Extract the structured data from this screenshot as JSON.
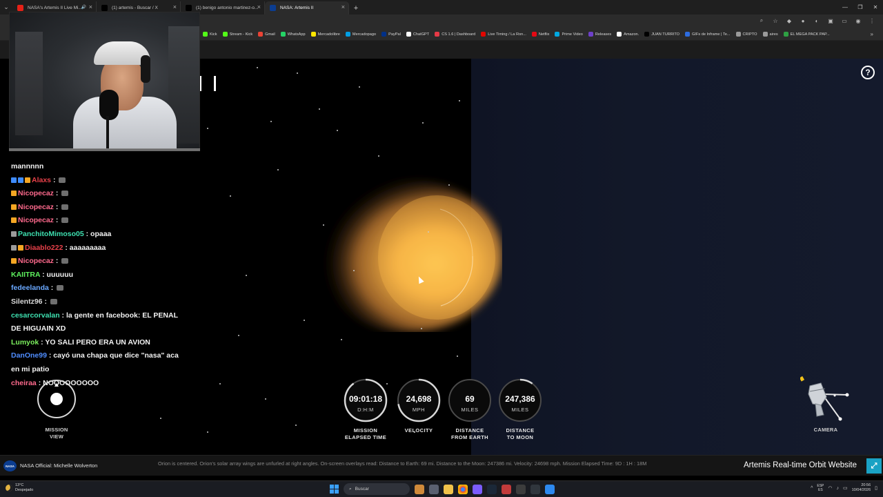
{
  "browser": {
    "tabs": [
      {
        "label": "NASA's Artemis II Live Mi...",
        "favicon_color": "#e62117",
        "active": false
      },
      {
        "label": "(1) artemis - Buscar / X",
        "favicon_color": "#000000",
        "active": false
      },
      {
        "label": "(1) benigo antonio martinez-o...",
        "favicon_color": "#000000",
        "active": false
      },
      {
        "label": "NASA: Artemis II",
        "favicon_color": "#0b3d91",
        "active": true
      }
    ],
    "new_tab_glyph": "+",
    "bookmarks": [
      {
        "label": "Kick",
        "color": "#53fc18"
      },
      {
        "label": "Stream - Kick",
        "color": "#53fc18"
      },
      {
        "label": "Gmail",
        "color": "#ea4335"
      },
      {
        "label": "WhatsApp",
        "color": "#25d366"
      },
      {
        "label": "Mercadolibre",
        "color": "#ffe600"
      },
      {
        "label": "Mercadopago",
        "color": "#009ee3"
      },
      {
        "label": "PayPal",
        "color": "#003087"
      },
      {
        "label": "ChatGPT",
        "color": "#ffffff"
      },
      {
        "label": "CS 1.6 | Dashboard",
        "color": "#e63946"
      },
      {
        "label": "Live Timing / La Ron...",
        "color": "#e10600"
      },
      {
        "label": "Netflix",
        "color": "#e50914"
      },
      {
        "label": "Prime Video",
        "color": "#00a8e1"
      },
      {
        "label": "Releases",
        "color": "#6e40c9"
      },
      {
        "label": "Amazon.",
        "color": "#ffffff"
      },
      {
        "label": "JUAN TURRITO",
        "color": "#000000"
      },
      {
        "label": "GIFs de Inframe | Te...",
        "color": "#2d6cdf"
      },
      {
        "label": "CRIPTO",
        "color": "#9a9a9a"
      },
      {
        "label": "aires",
        "color": "#9a9a9a"
      },
      {
        "label": "EL MEGA PACK PAP...",
        "color": "#2ea043"
      }
    ]
  },
  "chat": [
    {
      "user": "",
      "message": "mannnnn",
      "color": "#ffffff",
      "emote": false
    },
    {
      "user": "Alaxs",
      "message": "",
      "color": "#e8414a",
      "emote": true,
      "badges": [
        "#3f8cff",
        "#3f8cff",
        "#f5a623"
      ]
    },
    {
      "user": "Nicopecaz",
      "message": "",
      "color": "#ff6a8d",
      "emote": true,
      "badges": [
        "#f5a623"
      ]
    },
    {
      "user": "Nicopecaz",
      "message": "",
      "color": "#ff6a8d",
      "emote": true,
      "badges": [
        "#f5a623"
      ]
    },
    {
      "user": "Nicopecaz",
      "message": "",
      "color": "#ff6a8d",
      "emote": true,
      "badges": [
        "#f5a623"
      ]
    },
    {
      "user": "PanchitoMimoso05",
      "message": "opaaa",
      "color": "#3ee0b0",
      "emote": false,
      "badges": [
        "#9a9a9a"
      ]
    },
    {
      "user": "Diaablo222",
      "message": "aaaaaaaaa",
      "color": "#e8414a",
      "emote": false,
      "badges": [
        "#9a9a9a",
        "#f5a623"
      ]
    },
    {
      "user": "Nicopecaz",
      "message": "",
      "color": "#ff6a8d",
      "emote": true,
      "badges": [
        "#f5a623"
      ]
    },
    {
      "user": "KAIITRA",
      "message": "uuuuuu",
      "color": "#5ef05e",
      "emote": false
    },
    {
      "user": "fedeelanda",
      "message": "",
      "color": "#6aa8ff",
      "emote": true
    },
    {
      "user": "Silentz96",
      "message": "",
      "color": "#dcdcdc",
      "emote": true
    },
    {
      "user": "cesarcorvalan",
      "message": "la gente en facebook: EL PENAL DE HIGUAIN XD",
      "color": "#3ee0b0",
      "emote": false
    },
    {
      "user": "Lumyok",
      "message": "YO SALI PERO ERA UN AVION",
      "color": "#7cf05e",
      "emote": false
    },
    {
      "user": "DanOne99",
      "message": "cayó una chapa que dice \"nasa\" aca en mi patio",
      "color": "#4f8dff",
      "emote": false
    },
    {
      "user": "cheiraa",
      "message": "NOOOOOOOOO",
      "color": "#ff6a8d",
      "emote": false
    }
  ],
  "controls": {
    "help_glyph": "?",
    "mission_view_label_1": "MISSION",
    "mission_view_label_2": "VIEW",
    "camera_label": "CAMERA"
  },
  "stats": [
    {
      "value": "09:01:18",
      "unit": "D:H:M",
      "label_1": "MISSION",
      "label_2": "ELAPSED TIME",
      "fraction": 0.9
    },
    {
      "value": "24,698",
      "unit": "MPH",
      "label_1": "VELOCITY",
      "label_2": "",
      "fraction": 0.72
    },
    {
      "value": "69",
      "unit": "MILES",
      "label_1": "DISTANCE",
      "label_2": "FROM EARTH",
      "fraction": 0.0
    },
    {
      "value": "247,386",
      "unit": "MILES",
      "label_1": "DISTANCE",
      "label_2": "TO MOON",
      "fraction": 0.1
    }
  ],
  "stream_bar": {
    "speaker": "NASA Official: Michelle Wolverton",
    "ticker": "Orion is centered. Orion's solar array wings are unfurled at right angles. On-screen overlays read: Distance to Earth: 69 mi. Distance to the Moon: 247386 mi. Velocity: 24698 mph. Mission Elapsed Time: 9D : 1H : 18M",
    "site_title": "Artemis Real-time Orbit Website",
    "logo_text": "NASA"
  },
  "taskbar": {
    "weather_temp": "13°C",
    "weather_desc": "Despejado",
    "search_label": "Buscar",
    "lang_1": "ESP",
    "lang_2": "ES",
    "time": "20:56",
    "date": "10/04/2026"
  }
}
